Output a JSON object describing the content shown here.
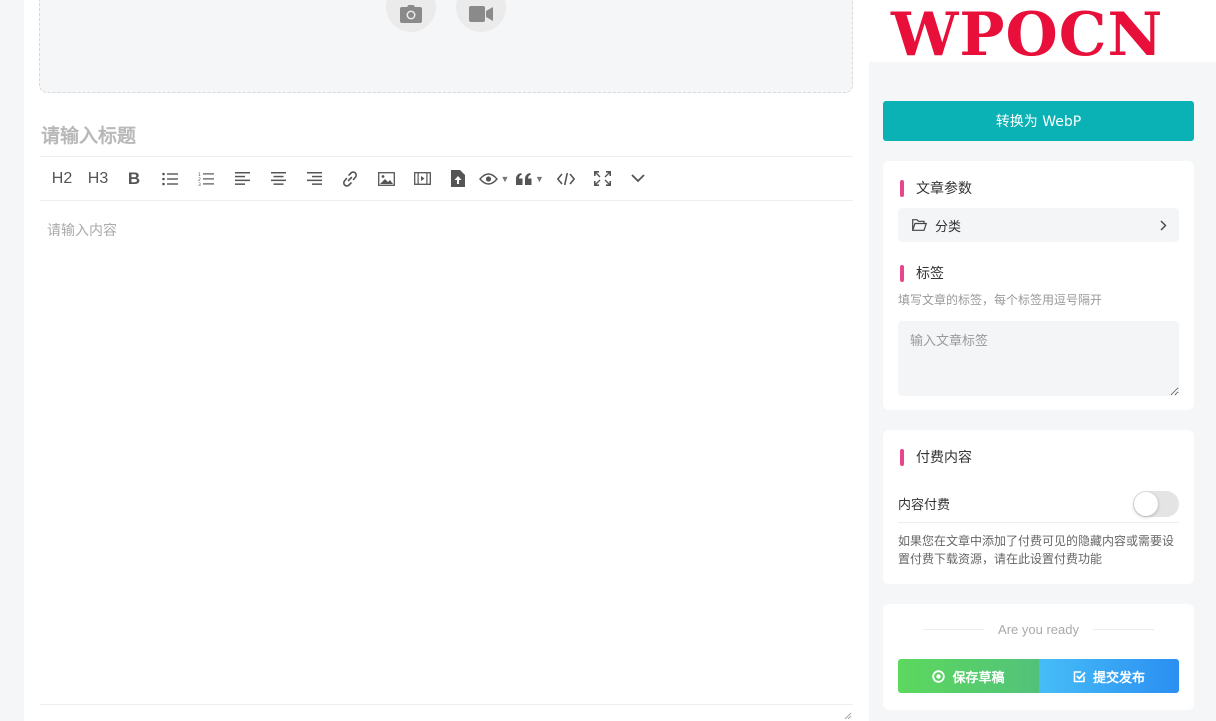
{
  "editor": {
    "upload": {
      "photo_icon": "camera-icon",
      "video_icon": "video-camera-icon"
    },
    "title_placeholder": "请输入标题",
    "content_placeholder": "请输入内容",
    "toolbar": {
      "h2_label": "H2",
      "h3_label": "H3",
      "bold_label": "B",
      "icons": [
        "bullet-list-icon",
        "numbered-list-icon",
        "align-left-icon",
        "align-center-icon",
        "align-right-icon",
        "link-icon",
        "image-icon",
        "video-icon",
        "file-upload-icon",
        "eye-icon",
        "quote-icon",
        "code-icon",
        "fullscreen-icon",
        "chevron-down-icon"
      ]
    }
  },
  "sidebar": {
    "logo_text": "WPOCN",
    "convert_button_label": "转换为 WebP",
    "params": {
      "title": "文章参数",
      "category_label": "分类",
      "tags_title": "标签",
      "tags_description": "填写文章的标签，每个标签用逗号隔开",
      "tags_placeholder": "输入文章标签"
    },
    "paid": {
      "title": "付费内容",
      "toggle_label": "内容付费",
      "toggle_on": false,
      "description": "如果您在文章中添加了付费可见的隐藏内容或需要设置付费下载资源，请在此设置付费功能"
    },
    "submit": {
      "ready_text": "Are you ready",
      "save_draft_label": "保存草稿",
      "publish_label": "提交发布"
    }
  },
  "colors": {
    "logo": "#e8103a",
    "convert_button": "#0ab2b6",
    "section_accent": "#e8468a",
    "draft_button": "#5cd85e",
    "publish_button": "#2b8ff2"
  }
}
